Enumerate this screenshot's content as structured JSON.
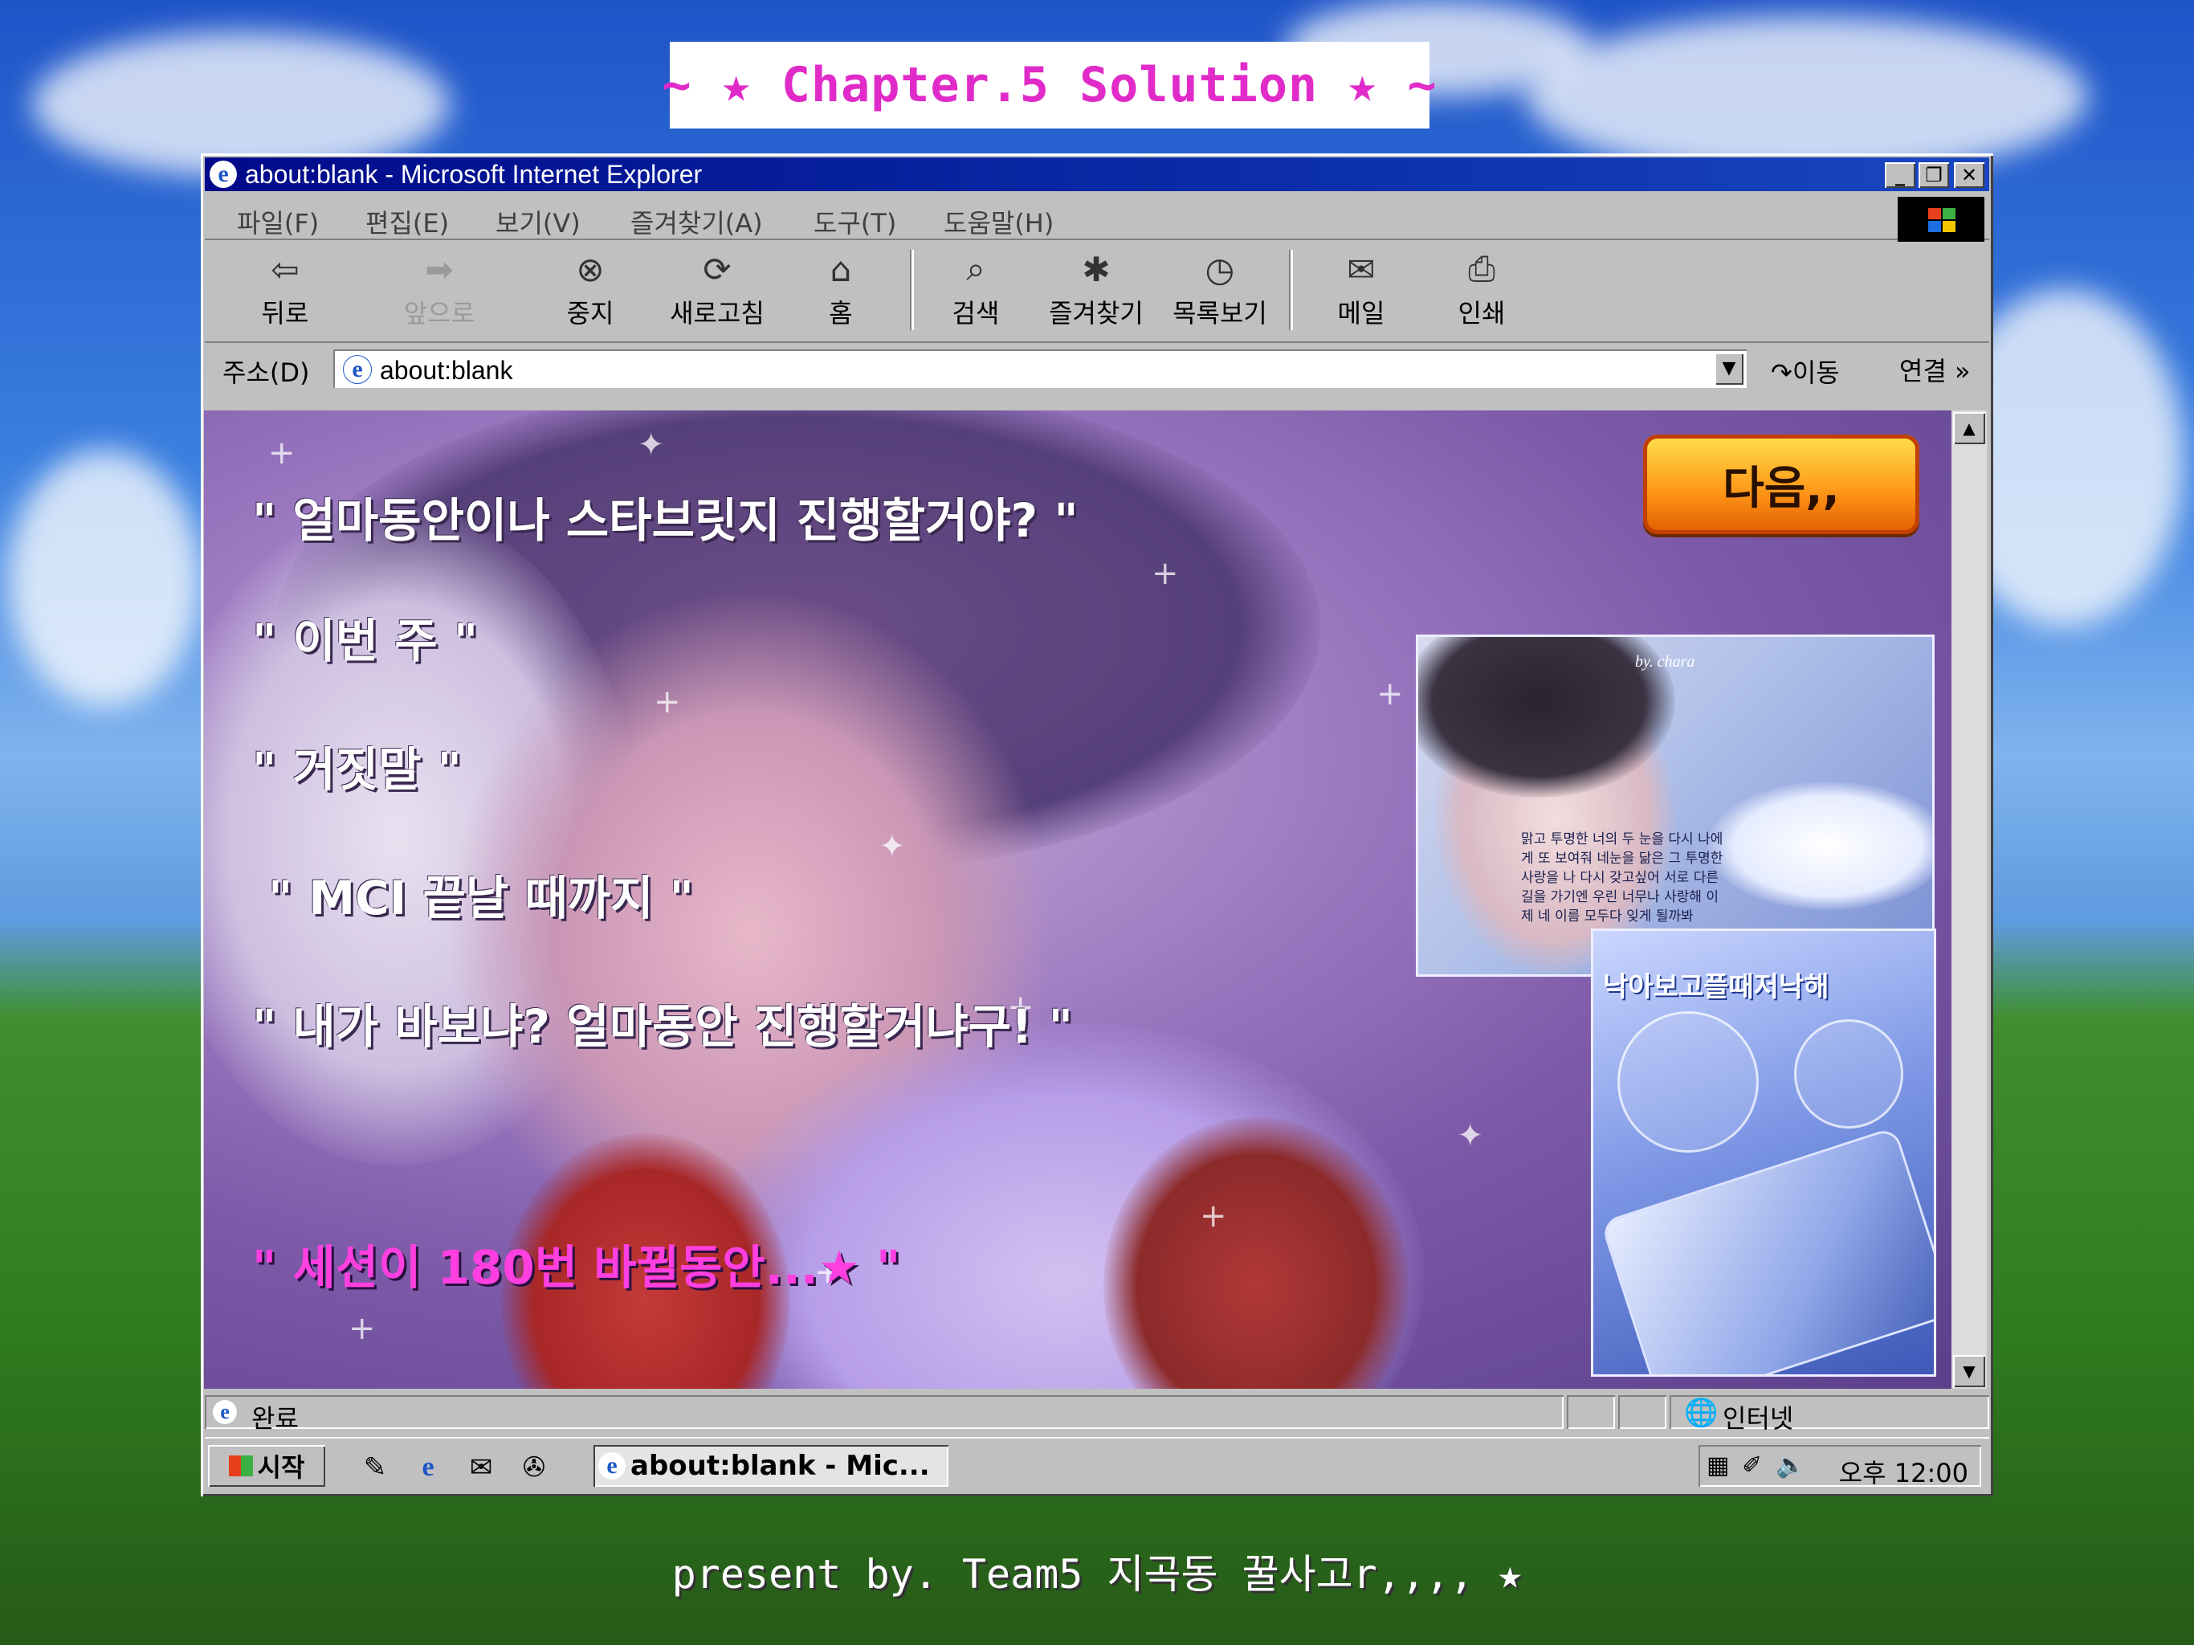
{
  "banner": {
    "title": "~ ★ Chapter.5 Solution ★ ~"
  },
  "window": {
    "title": "about:blank - Microsoft Internet Explorer",
    "minimize_label": "_",
    "restore_label": "❐",
    "close_label": "✕"
  },
  "menu": [
    "파일(F)",
    "편집(E)",
    "보기(V)",
    "즐겨찾기(A)",
    "도구(T)",
    "도움말(H)"
  ],
  "toolbar": {
    "back": "뒤로",
    "forward": "앞으로",
    "stop": "중지",
    "refresh": "새로고침",
    "home": "홈",
    "search": "검색",
    "favorites": "즐겨찾기",
    "history": "목록보기",
    "mail": "메일",
    "print": "인쇄"
  },
  "address": {
    "label": "주소(D)",
    "value": "about:blank",
    "go": "이동",
    "links": "연결 »"
  },
  "content": {
    "lines": [
      "\" 얼마동안이나 스타브릿지 진행할거야? \"",
      "\" 이번 주 \"",
      "\" 거짓말 \"",
      "\" MCI 끝날 때까지 \"",
      "\" 내가 바보냐? 얼마동안 진행할거냐구! \"",
      "\" 세션이 180번 바뀔동안...★ \""
    ],
    "next_button": "다음,,",
    "photo_signature": "by. chara",
    "photo_caption": "맑고 투명한 너의 두 눈을 다시 나에게 또 보여줘 네눈을 닮은 그 투명한 사랑을 나 다시 갖고싶어 서로 다른 길을 가기엔 우린 너무나 사랑해 이제 네 이름 모두다 잊게 될까봐",
    "photo_title": "낙아보고플때저낙해"
  },
  "status": {
    "text": "완료",
    "zone": "인터넷"
  },
  "taskbar": {
    "start": "시작",
    "task": "about:blank - Mic...",
    "clock": "오후 12:00"
  },
  "footer": {
    "text": "present by. Team5 지곡동 꿀사고r,,,, ★"
  }
}
